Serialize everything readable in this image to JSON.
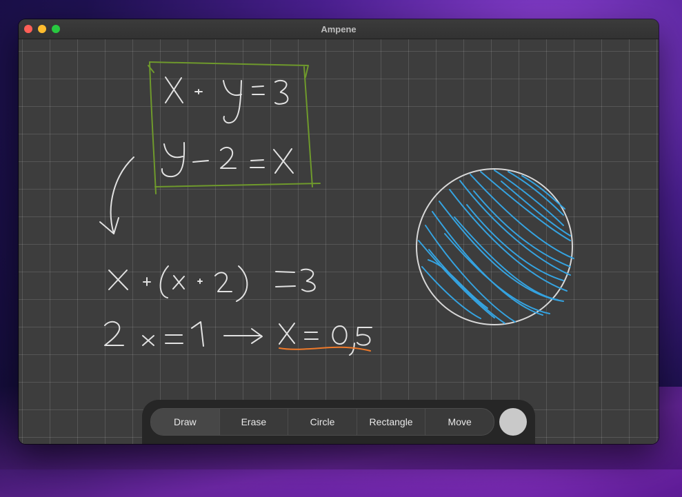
{
  "window": {
    "title": "Ampene"
  },
  "toolbar": {
    "tools": [
      "Draw",
      "Erase",
      "Circle",
      "Rectangle",
      "Move"
    ],
    "active_tool": "Draw",
    "selected_color": "#c9c9c9"
  },
  "canvas": {
    "ink_color": "#e2e2e2",
    "box_color": "#6f9a2c",
    "underline_color": "#f07a2a",
    "fill_color": "#35a3e0"
  }
}
